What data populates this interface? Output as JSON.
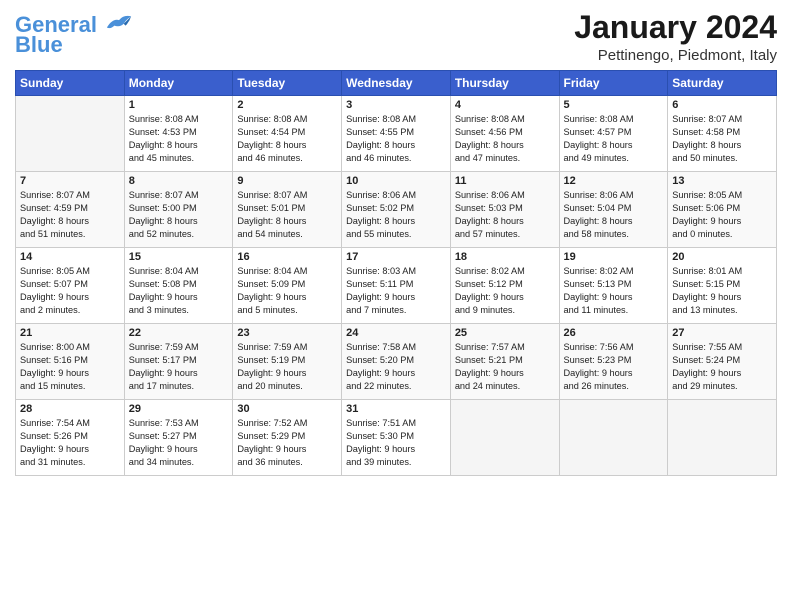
{
  "header": {
    "logo_line1": "General",
    "logo_line2": "Blue",
    "month_title": "January 2024",
    "location": "Pettinengo, Piedmont, Italy"
  },
  "days_of_week": [
    "Sunday",
    "Monday",
    "Tuesday",
    "Wednesday",
    "Thursday",
    "Friday",
    "Saturday"
  ],
  "weeks": [
    [
      {
        "day": "",
        "content": ""
      },
      {
        "day": "1",
        "content": "Sunrise: 8:08 AM\nSunset: 4:53 PM\nDaylight: 8 hours\nand 45 minutes."
      },
      {
        "day": "2",
        "content": "Sunrise: 8:08 AM\nSunset: 4:54 PM\nDaylight: 8 hours\nand 46 minutes."
      },
      {
        "day": "3",
        "content": "Sunrise: 8:08 AM\nSunset: 4:55 PM\nDaylight: 8 hours\nand 46 minutes."
      },
      {
        "day": "4",
        "content": "Sunrise: 8:08 AM\nSunset: 4:56 PM\nDaylight: 8 hours\nand 47 minutes."
      },
      {
        "day": "5",
        "content": "Sunrise: 8:08 AM\nSunset: 4:57 PM\nDaylight: 8 hours\nand 49 minutes."
      },
      {
        "day": "6",
        "content": "Sunrise: 8:07 AM\nSunset: 4:58 PM\nDaylight: 8 hours\nand 50 minutes."
      }
    ],
    [
      {
        "day": "7",
        "content": "Sunrise: 8:07 AM\nSunset: 4:59 PM\nDaylight: 8 hours\nand 51 minutes."
      },
      {
        "day": "8",
        "content": "Sunrise: 8:07 AM\nSunset: 5:00 PM\nDaylight: 8 hours\nand 52 minutes."
      },
      {
        "day": "9",
        "content": "Sunrise: 8:07 AM\nSunset: 5:01 PM\nDaylight: 8 hours\nand 54 minutes."
      },
      {
        "day": "10",
        "content": "Sunrise: 8:06 AM\nSunset: 5:02 PM\nDaylight: 8 hours\nand 55 minutes."
      },
      {
        "day": "11",
        "content": "Sunrise: 8:06 AM\nSunset: 5:03 PM\nDaylight: 8 hours\nand 57 minutes."
      },
      {
        "day": "12",
        "content": "Sunrise: 8:06 AM\nSunset: 5:04 PM\nDaylight: 8 hours\nand 58 minutes."
      },
      {
        "day": "13",
        "content": "Sunrise: 8:05 AM\nSunset: 5:06 PM\nDaylight: 9 hours\nand 0 minutes."
      }
    ],
    [
      {
        "day": "14",
        "content": "Sunrise: 8:05 AM\nSunset: 5:07 PM\nDaylight: 9 hours\nand 2 minutes."
      },
      {
        "day": "15",
        "content": "Sunrise: 8:04 AM\nSunset: 5:08 PM\nDaylight: 9 hours\nand 3 minutes."
      },
      {
        "day": "16",
        "content": "Sunrise: 8:04 AM\nSunset: 5:09 PM\nDaylight: 9 hours\nand 5 minutes."
      },
      {
        "day": "17",
        "content": "Sunrise: 8:03 AM\nSunset: 5:11 PM\nDaylight: 9 hours\nand 7 minutes."
      },
      {
        "day": "18",
        "content": "Sunrise: 8:02 AM\nSunset: 5:12 PM\nDaylight: 9 hours\nand 9 minutes."
      },
      {
        "day": "19",
        "content": "Sunrise: 8:02 AM\nSunset: 5:13 PM\nDaylight: 9 hours\nand 11 minutes."
      },
      {
        "day": "20",
        "content": "Sunrise: 8:01 AM\nSunset: 5:15 PM\nDaylight: 9 hours\nand 13 minutes."
      }
    ],
    [
      {
        "day": "21",
        "content": "Sunrise: 8:00 AM\nSunset: 5:16 PM\nDaylight: 9 hours\nand 15 minutes."
      },
      {
        "day": "22",
        "content": "Sunrise: 7:59 AM\nSunset: 5:17 PM\nDaylight: 9 hours\nand 17 minutes."
      },
      {
        "day": "23",
        "content": "Sunrise: 7:59 AM\nSunset: 5:19 PM\nDaylight: 9 hours\nand 20 minutes."
      },
      {
        "day": "24",
        "content": "Sunrise: 7:58 AM\nSunset: 5:20 PM\nDaylight: 9 hours\nand 22 minutes."
      },
      {
        "day": "25",
        "content": "Sunrise: 7:57 AM\nSunset: 5:21 PM\nDaylight: 9 hours\nand 24 minutes."
      },
      {
        "day": "26",
        "content": "Sunrise: 7:56 AM\nSunset: 5:23 PM\nDaylight: 9 hours\nand 26 minutes."
      },
      {
        "day": "27",
        "content": "Sunrise: 7:55 AM\nSunset: 5:24 PM\nDaylight: 9 hours\nand 29 minutes."
      }
    ],
    [
      {
        "day": "28",
        "content": "Sunrise: 7:54 AM\nSunset: 5:26 PM\nDaylight: 9 hours\nand 31 minutes."
      },
      {
        "day": "29",
        "content": "Sunrise: 7:53 AM\nSunset: 5:27 PM\nDaylight: 9 hours\nand 34 minutes."
      },
      {
        "day": "30",
        "content": "Sunrise: 7:52 AM\nSunset: 5:29 PM\nDaylight: 9 hours\nand 36 minutes."
      },
      {
        "day": "31",
        "content": "Sunrise: 7:51 AM\nSunset: 5:30 PM\nDaylight: 9 hours\nand 39 minutes."
      },
      {
        "day": "",
        "content": ""
      },
      {
        "day": "",
        "content": ""
      },
      {
        "day": "",
        "content": ""
      }
    ]
  ]
}
